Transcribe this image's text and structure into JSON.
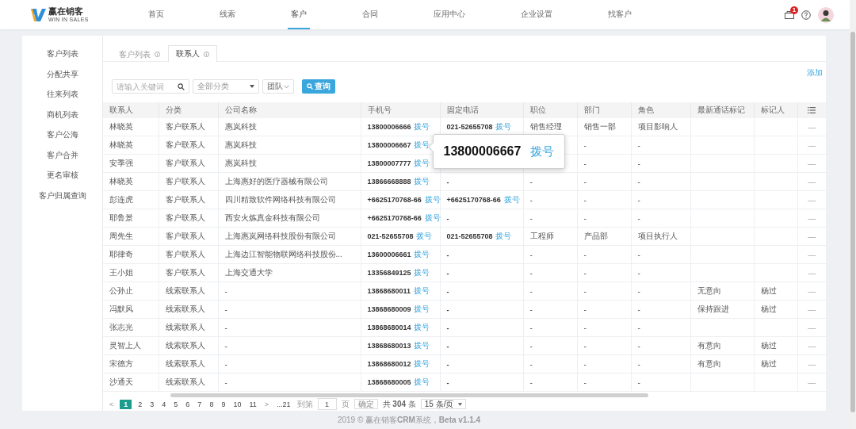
{
  "logo": {
    "name": "赢在销客",
    "tagline": "WIN IN SALES"
  },
  "nav": [
    {
      "label": "首页",
      "selected": false
    },
    {
      "label": "线索",
      "selected": false
    },
    {
      "label": "客户",
      "selected": true
    },
    {
      "label": "合同",
      "selected": false
    },
    {
      "label": "应用中心",
      "selected": false
    },
    {
      "label": "企业设置",
      "selected": false
    },
    {
      "label": "找客户",
      "selected": false
    }
  ],
  "header": {
    "notification_count": "1"
  },
  "sidebar": {
    "items": [
      "客户列表",
      "分配共享",
      "往来列表",
      "商机列表",
      "客户公海",
      "客户合并",
      "更名审核",
      "客户归属查询"
    ]
  },
  "tabs": [
    {
      "label": "客户列表",
      "selected": false
    },
    {
      "label": "联系人",
      "selected": true
    }
  ],
  "toolbar": {
    "search": {
      "placeholder": "请输入关键词"
    },
    "category": {
      "value": "全部分类"
    },
    "team": {
      "value": "团队"
    },
    "query_button": "查询",
    "add_link": "添加"
  },
  "table": {
    "columns": [
      "联系人",
      "分类",
      "公司名称",
      "手机号",
      "固定电话",
      "职位",
      "部门",
      "角色",
      "最新通话标记",
      "标记人"
    ],
    "rows": [
      {
        "name": "林晓英",
        "category": "客户联系人",
        "company": "惠岚科技",
        "mobile": "13800006666",
        "mobile_dial": "拨号",
        "landline": "021-52655708",
        "landline_dial": "拨号",
        "position": "销售经理",
        "department": "销售一部",
        "role": "项目影响人",
        "action": "—"
      },
      {
        "name": "林晓英",
        "category": "客户联系人",
        "company": "惠岚科技",
        "mobile": "13800006667",
        "mobile_dial": "拨号",
        "department": "-",
        "role": "-",
        "action": "—",
        "popover": {
          "number": "13800006667",
          "dial": "拨号"
        }
      },
      {
        "name": "安季强",
        "category": "客户联系人",
        "company": "惠岚科技",
        "mobile": "13800007777",
        "mobile_dial": "拨号",
        "department": "-",
        "role": "-",
        "action": "—"
      },
      {
        "name": "林晓英",
        "category": "客户联系人",
        "company": "上海惠好的医疗器械有限公司",
        "mobile": "13866668888",
        "mobile_dial": "拨号",
        "landline": "-",
        "position": "-",
        "department": "-",
        "role": "-",
        "action": "—"
      },
      {
        "name": "彭连虎",
        "category": "客户联系人",
        "company": "四川精致软件网络科技有限公司",
        "mobile": "+6625170768-66",
        "mobile_dial": "拨号",
        "landline": "+6625170768-66",
        "landline_dial": "拨号",
        "position": "-",
        "department": "-",
        "role": "-",
        "action": "—"
      },
      {
        "name": "耶鲁景",
        "category": "客户联系人",
        "company": "西安火炼真金科技有限公司",
        "mobile": "+6625170768-66",
        "mobile_dial": "拨号",
        "landline": "-",
        "position": "-",
        "department": "-",
        "role": "-",
        "action": "—"
      },
      {
        "name": "周先生",
        "category": "客户联系人",
        "company": "上海惠岚网络科技股份有限公司",
        "mobile": "021-52655708",
        "mobile_dial": "拨号",
        "landline": "021-52655708",
        "landline_dial": "拨号",
        "position": "工程师",
        "department": "产品部",
        "role": "项目执行人",
        "action": "—"
      },
      {
        "name": "耶律奇",
        "category": "客户联系人",
        "company": "上海边江智能物联网络科技股份...",
        "mobile": "13600006661",
        "mobile_dial": "拨号",
        "landline": "-",
        "position": "-",
        "department": "-",
        "role": "-",
        "action": "—"
      },
      {
        "name": "王小姐",
        "category": "客户联系人",
        "company": "上海交通大学",
        "mobile": "13356849125",
        "mobile_dial": "拨号",
        "landline": "-",
        "position": "-",
        "department": "-",
        "role": "-",
        "action": "—"
      },
      {
        "name": "公孙止",
        "category": "线索联系人",
        "company": "-",
        "mobile": "13868680011",
        "mobile_dial": "拨号",
        "landline": "-",
        "position": "-",
        "department": "-",
        "role": "-",
        "call_mark": "无意向",
        "marker": "杨过",
        "action": "—"
      },
      {
        "name": "冯默风",
        "category": "线索联系人",
        "company": "-",
        "mobile": "13868680009",
        "mobile_dial": "拨号",
        "landline": "-",
        "position": "-",
        "department": "-",
        "role": "-",
        "call_mark": "保持跟进",
        "marker": "杨过",
        "action": "—"
      },
      {
        "name": "张志光",
        "category": "线索联系人",
        "company": "-",
        "mobile": "13868680014",
        "mobile_dial": "拨号",
        "landline": "-",
        "position": "-",
        "department": "-",
        "role": "-",
        "action": "—"
      },
      {
        "name": "灵智上人",
        "category": "线索联系人",
        "company": "-",
        "mobile": "13868680013",
        "mobile_dial": "拨号",
        "landline": "-",
        "position": "-",
        "department": "-",
        "role": "-",
        "call_mark": "有意向",
        "marker": "杨过",
        "action": "—"
      },
      {
        "name": "宋德方",
        "category": "线索联系人",
        "company": "-",
        "mobile": "13868680012",
        "mobile_dial": "拨号",
        "landline": "-",
        "position": "-",
        "department": "-",
        "role": "-",
        "call_mark": "有意向",
        "marker": "杨过",
        "action": "—"
      },
      {
        "name": "沙通天",
        "category": "线索联系人",
        "company": "-",
        "mobile": "13868680005",
        "mobile_dial": "拨号",
        "landline": "-",
        "position": "-",
        "department": "-",
        "role": "-",
        "action": "—"
      }
    ]
  },
  "pagination": {
    "prev": "<",
    "pages": [
      {
        "label": "1",
        "selected": true
      },
      {
        "label": "2",
        "selected": false
      },
      {
        "label": "3",
        "selected": false
      },
      {
        "label": "4",
        "selected": false
      },
      {
        "label": "5",
        "selected": false
      },
      {
        "label": "6",
        "selected": false
      },
      {
        "label": "7",
        "selected": false
      },
      {
        "label": "8",
        "selected": false
      },
      {
        "label": "9",
        "selected": false
      },
      {
        "label": "10",
        "selected": false
      },
      {
        "label": "11",
        "selected": false
      }
    ],
    "next": ">",
    "last_page": "...21",
    "goto_label": "到第",
    "goto_value": "1",
    "page_unit": "页",
    "confirm": "确定",
    "total": "共 **304** 条",
    "page_size": "15 条/页"
  },
  "footer": "2019 © 赢在销客**CRM**系统，**Beta v1.1.4**"
}
